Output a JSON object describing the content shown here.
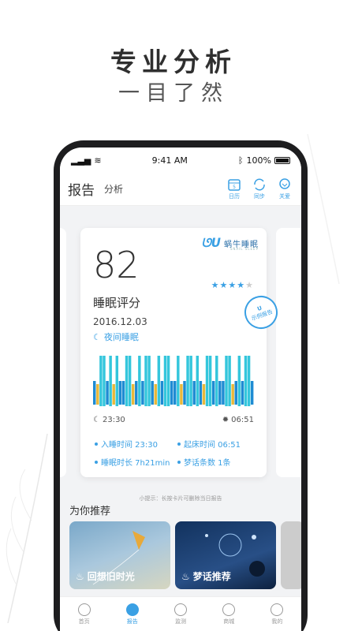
{
  "promo": {
    "title": "专业分析",
    "subtitle": "一目了然"
  },
  "status_bar": {
    "time": "9:41 AM",
    "battery": "100%"
  },
  "header": {
    "title": "报告",
    "secondary_tab": "分析",
    "actions": [
      {
        "label": "日历",
        "icon": "calendar-icon"
      },
      {
        "label": "同步",
        "icon": "sync-icon"
      },
      {
        "label": "关爱",
        "icon": "care-icon"
      }
    ]
  },
  "card": {
    "brand_name": "蜗牛睡眠",
    "brand_en": "SNAIL SLEEP",
    "score": "82",
    "score_label": "睡眠评分",
    "stars": 4,
    "stars_total": 5,
    "stamp_text": "示例报告",
    "date": "2016.12.03",
    "sleep_type": "夜间睡眠",
    "start_time": "23:30",
    "end_time": "06:51",
    "stats": [
      "入睡时间 23:30",
      "起床时间 06:51",
      "睡眠时长 7h21min",
      "梦话条数 1条"
    ]
  },
  "tip": "小提示：长按卡片可删除当日报告",
  "recommend": {
    "title": "为你推荐",
    "items": [
      {
        "label": "回想旧时光"
      },
      {
        "label": "梦话推荐"
      }
    ]
  },
  "tabbar": {
    "items": [
      {
        "label": "首页",
        "active": false
      },
      {
        "label": "报告",
        "active": true
      },
      {
        "label": "监测",
        "active": false
      },
      {
        "label": "商城",
        "active": false
      },
      {
        "label": "我的",
        "active": false
      }
    ]
  },
  "colors": {
    "accent": "#3aa0e4",
    "deep": "#1e8bd3",
    "light": "#34c6dc",
    "awake": "#e8b83a"
  }
}
